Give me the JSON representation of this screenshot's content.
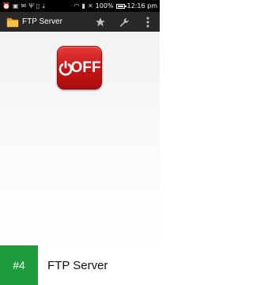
{
  "status_bar": {
    "battery_text": "100%",
    "time": "12:16",
    "time_suffix": "pm",
    "battery_level": 1.0
  },
  "action_bar": {
    "title": "FTP Server",
    "actions": [
      {
        "name": "star-icon"
      },
      {
        "name": "wrench-icon"
      },
      {
        "name": "overflow-menu-icon"
      }
    ]
  },
  "main": {
    "power_toggle": {
      "label": "OFF",
      "color": "#cc1818"
    }
  },
  "footer": {
    "rank_badge": "#4",
    "app_name": "FTP Server",
    "badge_color": "#1e9b3a"
  }
}
